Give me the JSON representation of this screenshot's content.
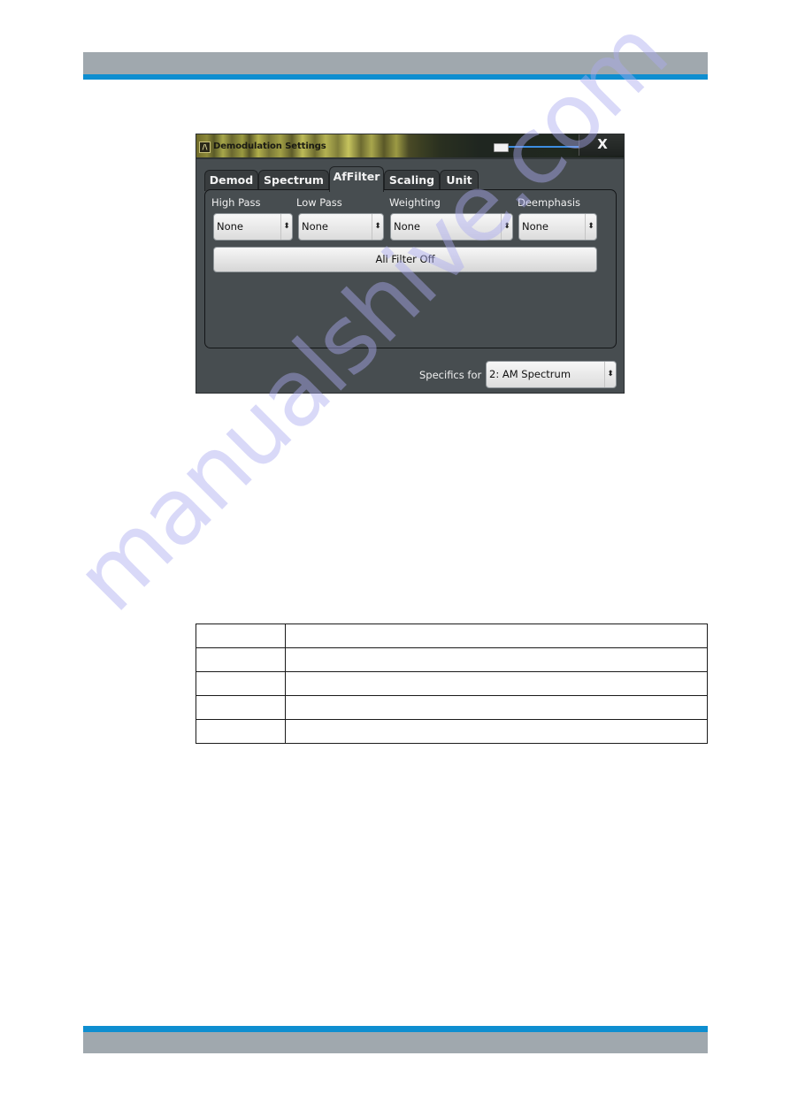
{
  "page": {
    "header_colors": {
      "bar": "#a0a8ae",
      "accent": "#0e8ed0"
    },
    "footer_colors": {
      "bar": "#a0a8ae",
      "accent": "#0e8ed0"
    }
  },
  "dialog": {
    "title": "Demodulation Settings",
    "app_icon": "rs-logo-icon",
    "close_label": "X",
    "tabs": [
      {
        "label": "Demod",
        "active": false
      },
      {
        "label": "Spectrum",
        "active": false
      },
      {
        "label": "AfFilter",
        "active": true
      },
      {
        "label": "Scaling",
        "active": false
      },
      {
        "label": "Unit",
        "active": false
      }
    ],
    "filters": [
      {
        "label": "High Pass",
        "value": "None"
      },
      {
        "label": "Low Pass",
        "value": "None"
      },
      {
        "label": "Weighting",
        "value": "None"
      },
      {
        "label": "Deemphasis",
        "value": "None"
      }
    ],
    "all_filter_off_label": "All Filter Off",
    "specifics_label": "Specifics for",
    "specifics_value": "2: AM Spectrum",
    "select_arrows": "⬍"
  },
  "table": {
    "rows": [
      [
        "",
        ""
      ],
      [
        "",
        ""
      ],
      [
        "",
        ""
      ],
      [
        "",
        ""
      ],
      [
        "",
        ""
      ]
    ]
  },
  "watermark": "manualshive.com"
}
